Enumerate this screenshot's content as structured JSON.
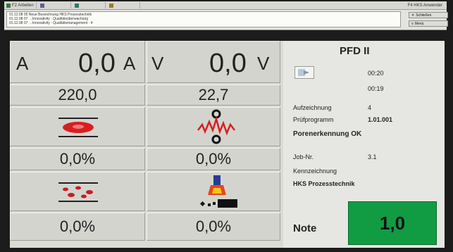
{
  "taskbar": {
    "items": [
      {
        "label": "F2 Arbeiten",
        "color": "#3a7b3a"
      },
      {
        "label": "",
        "color": "#6a5a9a"
      },
      {
        "label": "",
        "color": "#2d7a6a"
      },
      {
        "label": "",
        "color": "#a07a20"
      }
    ],
    "right_label": "F4 HKS Anwender"
  },
  "log": {
    "lines": [
      "01.12.08 05  Neue Bezeichnung HKS Prozesstechnik",
      "01.12.08 07  →Innovativity · Qualitätsüberwachung",
      "01.12.08 07  →Innovativity · Qualitätsmanagement · 4"
    ]
  },
  "side_buttons": {
    "top": "Schließen",
    "bottom": "Menü"
  },
  "current": {
    "label": "A",
    "value": "0,0",
    "unit": "A",
    "setpoint": "220,0"
  },
  "voltage": {
    "label": "V",
    "value": "0,0",
    "unit": "V",
    "setpoint": "22,7"
  },
  "indicators": {
    "row1_left": "0,0%",
    "row1_right": "0,0%",
    "row2_left": "0,0%",
    "row2_right": "0,0%"
  },
  "panel": {
    "title": "PFD II",
    "time1": "00:20",
    "time2": "00:19",
    "aufzeichnung_label": "Aufzeichnung",
    "aufzeichnung_value": "4",
    "pruefprogramm_label": "Prüfprogramm",
    "pruefprogramm_value": "1.01.001",
    "status": "Porenerkennung OK",
    "job_label": "Job-Nr.",
    "job_value": "3.1",
    "kennzeichnung_label": "Kennzeichnung",
    "kennzeichnung_value": "HKS Prozesstechnik",
    "note_label": "Note",
    "note_value": "1,0",
    "note_color": "#119c44"
  }
}
